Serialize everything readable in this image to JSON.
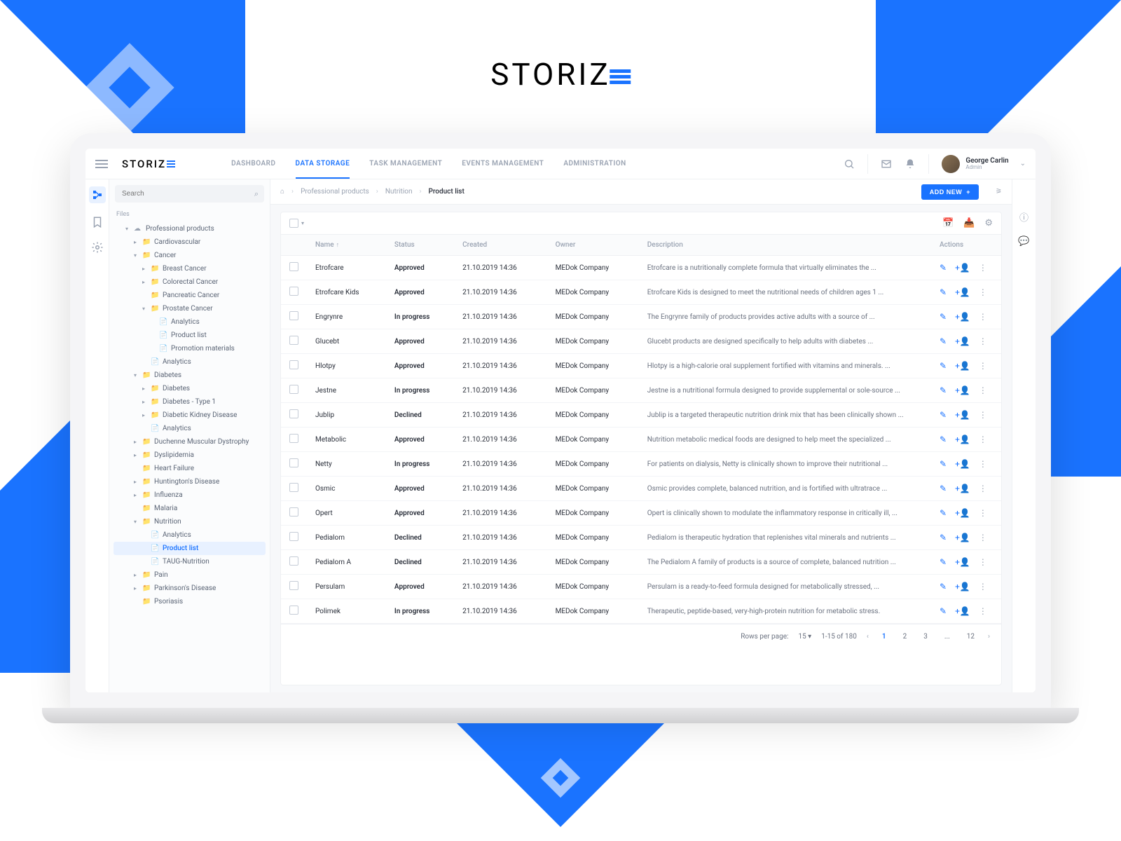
{
  "brand": "STORIZ",
  "nav": {
    "tabs": [
      "DASHBOARD",
      "DATA STORAGE",
      "TASK MANAGEMENT",
      "EVENTS MANAGEMENT",
      "ADMINISTRATION"
    ],
    "active": 1
  },
  "user": {
    "name": "George Carlin",
    "role": "Admin"
  },
  "search": {
    "placeholder": "Search"
  },
  "sidebar": {
    "label": "Files",
    "tree": [
      {
        "t": "Professional products",
        "i": 1,
        "a": "down",
        "ic": "cloud"
      },
      {
        "t": "Cardiovascular",
        "i": 2,
        "a": "right",
        "ic": "folder"
      },
      {
        "t": "Cancer",
        "i": 2,
        "a": "down",
        "ic": "folder"
      },
      {
        "t": "Breast Cancer",
        "i": 3,
        "a": "right",
        "ic": "folder"
      },
      {
        "t": "Colorectal Cancer",
        "i": 3,
        "a": "right",
        "ic": "folder"
      },
      {
        "t": "Pancreatic Cancer",
        "i": 3,
        "a": "",
        "ic": "folder"
      },
      {
        "t": "Prostate Cancer",
        "i": 3,
        "a": "down",
        "ic": "folder"
      },
      {
        "t": "Analytics",
        "i": 4,
        "a": "",
        "ic": "file"
      },
      {
        "t": "Product list",
        "i": 4,
        "a": "",
        "ic": "file"
      },
      {
        "t": "Promotion materials",
        "i": 4,
        "a": "",
        "ic": "file"
      },
      {
        "t": "Analytics",
        "i": 3,
        "a": "",
        "ic": "file"
      },
      {
        "t": "Diabetes",
        "i": 2,
        "a": "down",
        "ic": "folder"
      },
      {
        "t": "Diabetes",
        "i": 3,
        "a": "right",
        "ic": "folder"
      },
      {
        "t": "Diabetes - Type 1",
        "i": 3,
        "a": "right",
        "ic": "folder"
      },
      {
        "t": "Diabetic Kidney Disease",
        "i": 3,
        "a": "right",
        "ic": "folder"
      },
      {
        "t": "Analytics",
        "i": 3,
        "a": "",
        "ic": "file"
      },
      {
        "t": "Duchenne Muscular Dystrophy",
        "i": 2,
        "a": "right",
        "ic": "folder"
      },
      {
        "t": "Dyslipidemia",
        "i": 2,
        "a": "right",
        "ic": "folder"
      },
      {
        "t": "Heart Failure",
        "i": 2,
        "a": "",
        "ic": "folder"
      },
      {
        "t": "Huntington's Disease",
        "i": 2,
        "a": "right",
        "ic": "folder"
      },
      {
        "t": "Influenza",
        "i": 2,
        "a": "right",
        "ic": "folder"
      },
      {
        "t": "Malaria",
        "i": 2,
        "a": "",
        "ic": "folder"
      },
      {
        "t": "Nutrition",
        "i": 2,
        "a": "down",
        "ic": "folder"
      },
      {
        "t": "Analytics",
        "i": 3,
        "a": "",
        "ic": "file"
      },
      {
        "t": "Product list",
        "i": 3,
        "a": "",
        "ic": "file",
        "sel": true
      },
      {
        "t": "TAUG-Nutrition",
        "i": 3,
        "a": "",
        "ic": "file"
      },
      {
        "t": "Pain",
        "i": 2,
        "a": "right",
        "ic": "folder"
      },
      {
        "t": "Parkinson's Disease",
        "i": 2,
        "a": "right",
        "ic": "folder"
      },
      {
        "t": "Psoriasis",
        "i": 2,
        "a": "",
        "ic": "folder"
      }
    ]
  },
  "breadcrumb": [
    "Professional products",
    "Nutrition",
    "Product list"
  ],
  "addBtn": "ADD NEW",
  "table": {
    "columns": [
      "Name",
      "Status",
      "Created",
      "Owner",
      "Description",
      "Actions"
    ],
    "rows": [
      {
        "name": "Etrofcare",
        "status": "Approved",
        "created": "21.10.2019 14:36",
        "owner": "MEDok Company",
        "desc": "Etrofcare is a nutritionally complete formula that virtually eliminates the ..."
      },
      {
        "name": "Etrofcare Kids",
        "status": "Approved",
        "created": "21.10.2019 14:36",
        "owner": "MEDok Company",
        "desc": "Etrofcare Kids is designed to meet the nutritional needs of children ages 1 ..."
      },
      {
        "name": "Engrynre",
        "status": "In progress",
        "created": "21.10.2019 14:36",
        "owner": "MEDok Company",
        "desc": "The Engrynre family of products provides active adults with a source of ..."
      },
      {
        "name": "Glucebt",
        "status": "Approved",
        "created": "21.10.2019 14:36",
        "owner": "MEDok Company",
        "desc": "Glucebt products are designed specifically to help adults with diabetes ..."
      },
      {
        "name": "Hlotpy",
        "status": "Approved",
        "created": "21.10.2019 14:36",
        "owner": "MEDok Company",
        "desc": "Hlotpy is a high-calorie oral supplement fortified with vitamins and minerals. ..."
      },
      {
        "name": "Jestne",
        "status": "In progress",
        "created": "21.10.2019 14:36",
        "owner": "MEDok Company",
        "desc": "Jestne is a nutritional formula designed to provide supplemental or sole-source ..."
      },
      {
        "name": "Jublip",
        "status": "Declined",
        "created": "21.10.2019 14:36",
        "owner": "MEDok Company",
        "desc": "Jublip is a targeted therapeutic nutrition drink mix that has been clinically shown ..."
      },
      {
        "name": "Metabolic",
        "status": "Approved",
        "created": "21.10.2019 14:36",
        "owner": "MEDok Company",
        "desc": "Nutrition metabolic medical foods are designed to help meet the specialized ..."
      },
      {
        "name": "Netty",
        "status": "In progress",
        "created": "21.10.2019 14:36",
        "owner": "MEDok Company",
        "desc": "For patients on dialysis, Netty is clinically shown to improve their nutritional ..."
      },
      {
        "name": "Osmic",
        "status": "Approved",
        "created": "21.10.2019 14:36",
        "owner": "MEDok Company",
        "desc": "Osmic provides complete, balanced nutrition, and is fortified with ultratrace ..."
      },
      {
        "name": "Opert",
        "status": "Approved",
        "created": "21.10.2019 14:36",
        "owner": "MEDok Company",
        "desc": "Opert is clinically shown to modulate the inflammatory response in critically ill, ..."
      },
      {
        "name": "Pedialom",
        "status": "Declined",
        "created": "21.10.2019 14:36",
        "owner": "MEDok Company",
        "desc": "Pedialom is therapeutic hydration that replenishes vital minerals and nutrients ..."
      },
      {
        "name": "Pedialom A",
        "status": "Declined",
        "created": "21.10.2019 14:36",
        "owner": "MEDok Company",
        "desc": "The Pedialom A family of products is a source of complete, balanced nutrition ..."
      },
      {
        "name": "Persulam",
        "status": "Approved",
        "created": "21.10.2019 14:36",
        "owner": "MEDok Company",
        "desc": "Persulam is a ready-to-feed formula designed for metabolically stressed, ..."
      },
      {
        "name": "Polimek",
        "status": "In progress",
        "created": "21.10.2019 14:36",
        "owner": "MEDok Company",
        "desc": "Therapeutic, peptide-based, very-high-protein nutrition for metabolic stress."
      }
    ]
  },
  "pagination": {
    "rowsLabel": "Rows per page:",
    "rowsValue": "15",
    "range": "1-15 of 180",
    "pages": [
      "1",
      "2",
      "3",
      "...",
      "12"
    ]
  }
}
